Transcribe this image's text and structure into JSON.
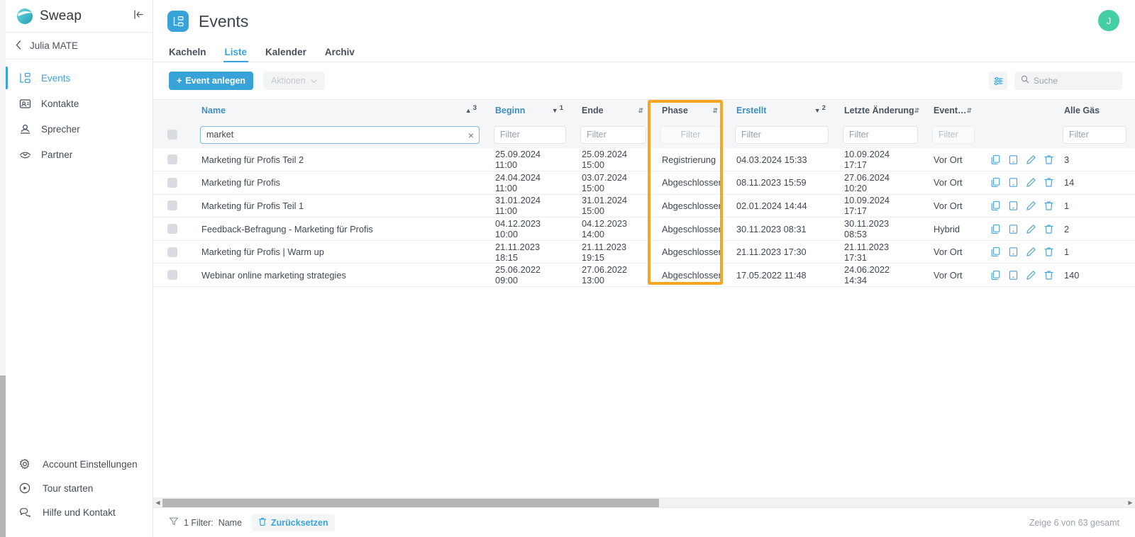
{
  "sidebar": {
    "brand": {
      "name": "Sweap",
      "collapse_icon": "collapse-left-icon"
    },
    "account": {
      "name": "Julia MATE",
      "back_icon": "chevron-left-icon"
    },
    "items": [
      {
        "label": "Events",
        "icon": "events-hierarchy-icon",
        "active": true
      },
      {
        "label": "Kontakte",
        "icon": "contacts-card-icon",
        "active": false
      },
      {
        "label": "Sprecher",
        "icon": "speaker-person-icon",
        "active": false
      },
      {
        "label": "Partner",
        "icon": "partner-handshake-icon",
        "active": false
      }
    ],
    "bottom_items": [
      {
        "label": "Account Einstellungen",
        "icon": "gear-icon"
      },
      {
        "label": "Tour starten",
        "icon": "play-circle-icon"
      },
      {
        "label": "Hilfe und Kontakt",
        "icon": "chat-help-icon"
      }
    ]
  },
  "header": {
    "title": "Events",
    "icon": "events-hierarchy-icon",
    "avatar_initial": "J",
    "avatar_color": "#42cfa4"
  },
  "tabs": [
    {
      "label": "Kacheln",
      "active": false
    },
    {
      "label": "Liste",
      "active": true
    },
    {
      "label": "Kalender",
      "active": false
    },
    {
      "label": "Archiv",
      "active": false
    }
  ],
  "toolbar": {
    "create_label": "Event anlegen",
    "create_plus": "+",
    "actions_label": "Aktionen",
    "actions_caret": "⌄",
    "settings_icon": "sliders-icon",
    "search_icon": "search-icon",
    "search_placeholder": "Suche",
    "search_value": ""
  },
  "table": {
    "columns": [
      {
        "key": "chk",
        "label": "",
        "sorted": false,
        "sort_dir": "none",
        "sort_num": "",
        "filter_placeholder": "",
        "filter_value": "",
        "filter_disabled": true,
        "has_filter": false
      },
      {
        "key": "name",
        "label": "Name",
        "sorted": true,
        "sort_dir": "asc",
        "sort_num": "3",
        "filter_placeholder": "Filter",
        "filter_value": "market",
        "filter_disabled": false,
        "has_filter": true
      },
      {
        "key": "beg",
        "label": "Beginn",
        "sorted": true,
        "sort_dir": "desc",
        "sort_num": "1",
        "filter_placeholder": "Filter",
        "filter_value": "",
        "filter_disabled": false,
        "has_filter": true
      },
      {
        "key": "end",
        "label": "Ende",
        "sorted": false,
        "sort_dir": "none",
        "sort_num": "",
        "filter_placeholder": "Filter",
        "filter_value": "",
        "filter_disabled": false,
        "has_filter": true
      },
      {
        "key": "phase",
        "label": "Phase",
        "sorted": false,
        "sort_dir": "none",
        "sort_num": "",
        "filter_placeholder": "Filter",
        "filter_value": "",
        "filter_disabled": true,
        "has_filter": true
      },
      {
        "key": "erst",
        "label": "Erstellt",
        "sorted": true,
        "sort_dir": "desc",
        "sort_num": "2",
        "filter_placeholder": "Filter",
        "filter_value": "",
        "filter_disabled": false,
        "has_filter": true
      },
      {
        "key": "letzt",
        "label": "Letzte Änderung",
        "sorted": false,
        "sort_dir": "none",
        "sort_num": "",
        "filter_placeholder": "Filter",
        "filter_value": "",
        "filter_disabled": false,
        "has_filter": true
      },
      {
        "key": "typ",
        "label": "Event…",
        "sorted": false,
        "sort_dir": "none",
        "sort_num": "",
        "filter_placeholder": "Filter",
        "filter_value": "",
        "filter_disabled": true,
        "has_filter": true
      },
      {
        "key": "act",
        "label": "",
        "sorted": false,
        "sort_dir": "none",
        "sort_num": "",
        "filter_placeholder": "",
        "filter_value": "",
        "filter_disabled": true,
        "has_filter": false
      },
      {
        "key": "gast",
        "label": "Alle Gäs",
        "sorted": false,
        "sort_dir": "none",
        "sort_num": "",
        "filter_placeholder": "Filter",
        "filter_value": "",
        "filter_disabled": false,
        "has_filter": true
      }
    ],
    "name_filter_clear_icon": "clear-x-icon",
    "row_actions": [
      {
        "icon": "duplicate-icon"
      },
      {
        "icon": "tablet-checkin-icon"
      },
      {
        "icon": "edit-pencil-icon"
      },
      {
        "icon": "delete-trash-icon"
      }
    ],
    "rows": [
      {
        "name": "Marketing für Profis Teil 2",
        "beginn": "25.09.2024 11:00",
        "ende": "25.09.2024 15:00",
        "phase": "Registrierung",
        "erstellt": "04.03.2024 15:33",
        "letzte": "10.09.2024 17:17",
        "typ": "Vor Ort",
        "gaeste": "3"
      },
      {
        "name": "Marketing für Profis",
        "beginn": "24.04.2024 11:00",
        "ende": "03.07.2024 15:00",
        "phase": "Abgeschlossen",
        "erstellt": "08.11.2023 15:59",
        "letzte": "27.06.2024 10:20",
        "typ": "Vor Ort",
        "gaeste": "14"
      },
      {
        "name": "Marketing für Profis Teil 1",
        "beginn": "31.01.2024 11:00",
        "ende": "31.01.2024 15:00",
        "phase": "Abgeschlossen",
        "erstellt": "02.01.2024 14:44",
        "letzte": "10.09.2024 17:17",
        "typ": "Vor Ort",
        "gaeste": "1"
      },
      {
        "name": "Feedback-Befragung - Marketing für Profis",
        "beginn": "04.12.2023 10:00",
        "ende": "04.12.2023 14:00",
        "phase": "Abgeschlossen",
        "erstellt": "30.11.2023 08:31",
        "letzte": "30.11.2023 08:53",
        "typ": "Hybrid",
        "gaeste": "2"
      },
      {
        "name": "Marketing für Profis | Warm up",
        "beginn": "21.11.2023 18:15",
        "ende": "21.11.2023 19:15",
        "phase": "Abgeschlossen",
        "erstellt": "21.11.2023 17:30",
        "letzte": "21.11.2023 17:31",
        "typ": "Vor Ort",
        "gaeste": "1"
      },
      {
        "name": "Webinar online marketing strategies",
        "beginn": "25.06.2022 09:00",
        "ende": "27.06.2022 13:00",
        "phase": "Abgeschlossen",
        "erstellt": "17.05.2022 11:48",
        "letzte": "24.06.2022 14:34",
        "typ": "Vor Ort",
        "gaeste": "140"
      }
    ],
    "highlight_color": "#f5a623",
    "highlighted_column": "phase"
  },
  "footer": {
    "filter_icon": "funnel-icon",
    "filter_text": "1 Filter:",
    "filter_field": "Name",
    "reset_icon": "delete-trash-icon",
    "reset_label": "Zurücksetzen",
    "count_text": "Zeige 6 von 63 gesamt"
  }
}
